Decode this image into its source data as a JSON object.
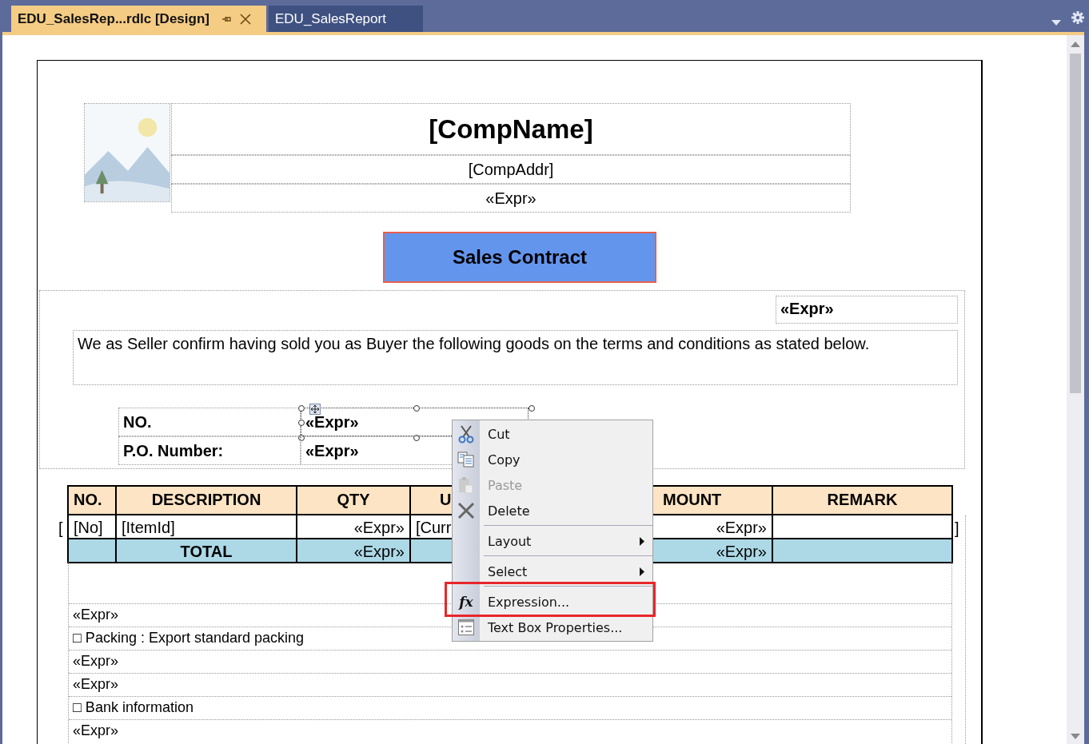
{
  "tabs": [
    {
      "label": "EDU_SalesRep...rdlc [Design]",
      "selected": true
    },
    {
      "label": "EDU_SalesReport",
      "selected": false
    }
  ],
  "report": {
    "header": {
      "company_name": "[CompName]",
      "company_address": "[CompAddr]",
      "expression": "«Expr»"
    },
    "title": "Sales Contract",
    "date_field": "«Expr»",
    "intro": "We as Seller confirm having sold you as Buyer the following goods on the terms and conditions as stated below.",
    "info_rows": [
      {
        "label": "NO.",
        "value": "«Expr»",
        "selected": true
      },
      {
        "label": "P.O. Number:",
        "value": "«Expr»",
        "selected": false
      }
    ],
    "table": {
      "columns": [
        "NO.",
        "DESCRIPTION",
        "QTY",
        "U",
        "MOUNT",
        "REMARK"
      ],
      "left_mark": "[",
      "right_mark": "]",
      "rows": [
        {
          "kind": "detail",
          "cells": [
            {
              "text": "[No]"
            },
            {
              "text": "[ItemId]"
            },
            {
              "text": "«Expr»"
            },
            {
              "text": "[Curr"
            },
            {
              "text": "«Expr»"
            },
            {}
          ]
        },
        {
          "kind": "total",
          "cells": [
            {},
            {
              "text": "TOTAL"
            },
            {
              "text": "«Expr»"
            },
            {},
            {
              "text": "«Expr»"
            },
            {}
          ]
        }
      ]
    },
    "notes": [
      "«Expr»",
      "□ Packing : Export standard packing",
      "«Expr»",
      "«Expr»",
      "□ Bank information",
      "«Expr»"
    ]
  },
  "context_menu": {
    "items": [
      {
        "kind": "command",
        "label": "Cut",
        "disabled": false,
        "highlighted": false
      },
      {
        "kind": "command",
        "label": "Copy",
        "disabled": false,
        "highlighted": false
      },
      {
        "kind": "command",
        "label": "Paste",
        "disabled": true,
        "highlighted": false
      },
      {
        "kind": "command",
        "label": "Delete",
        "disabled": false,
        "highlighted": false
      },
      {
        "kind": "separator"
      },
      {
        "kind": "submenu",
        "label": "Layout",
        "disabled": false,
        "highlighted": false
      },
      {
        "kind": "separator"
      },
      {
        "kind": "submenu",
        "label": "Select",
        "disabled": false,
        "highlighted": false
      },
      {
        "kind": "separator"
      },
      {
        "kind": "command",
        "label": "Expression...",
        "glyph": "fx",
        "disabled": false,
        "highlighted": true
      },
      {
        "kind": "command",
        "label": "Text Box Properties...",
        "disabled": false,
        "highlighted": false
      }
    ]
  }
}
